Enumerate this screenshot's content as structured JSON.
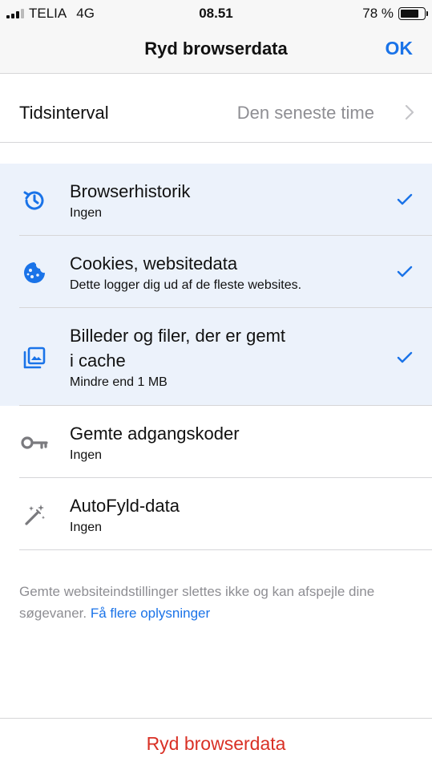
{
  "status_bar": {
    "carrier": "TELIA",
    "network": "4G",
    "time": "08.51",
    "battery_percent": "78 %",
    "battery_level": 0.78
  },
  "nav": {
    "title": "Ryd browserdata",
    "ok_label": "OK"
  },
  "time_range": {
    "label": "Tidsinterval",
    "value": "Den seneste time"
  },
  "items": [
    {
      "icon": "history-icon",
      "title": "Browserhistorik",
      "subtitle": "Ingen",
      "selected": true
    },
    {
      "icon": "cookie-icon",
      "title": "Cookies, websitedata",
      "subtitle": "Dette logger dig ud af de fleste websites.",
      "selected": true
    },
    {
      "icon": "image-cache-icon",
      "title_line1": "Billeder og filer, der er gemt",
      "title_line2": "i cache",
      "subtitle": "Mindre end 1 MB",
      "selected": true
    },
    {
      "icon": "key-icon",
      "title": "Gemte adgangskoder",
      "subtitle": "Ingen",
      "selected": false
    },
    {
      "icon": "magic-wand-icon",
      "title": "AutoFyld-data",
      "subtitle": "Ingen",
      "selected": false
    }
  ],
  "footer": {
    "note": "Gemte websiteindstillinger slettes ikke og kan afspejle dine søgevaner.",
    "link": "Få flere oplysninger"
  },
  "bottom": {
    "clear_label": "Ryd browserdata"
  },
  "colors": {
    "accent": "#1a73e8",
    "destructive": "#d93025",
    "selected_row": "#ecf2fb",
    "secondary_text": "#8e8e93"
  }
}
